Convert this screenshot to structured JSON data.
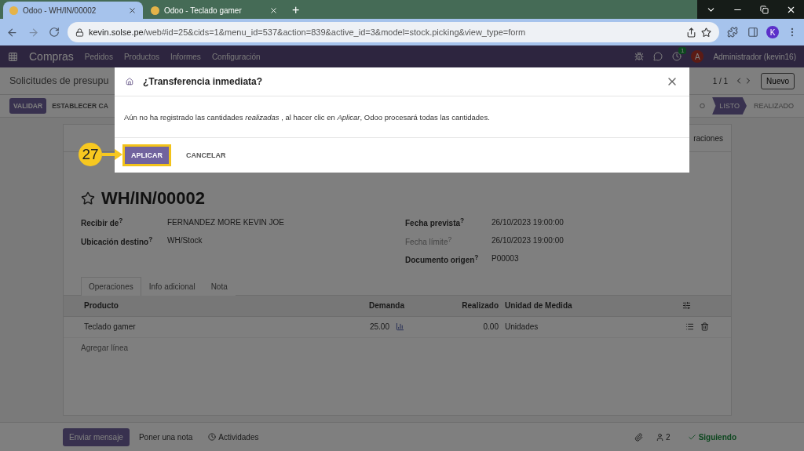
{
  "browser": {
    "tabs": [
      {
        "title": "Odoo - WH/IN/00002",
        "selected": true
      },
      {
        "title": "Odoo - Teclado gamer",
        "selected": false
      }
    ],
    "new_tab": "+",
    "url_host": "kevin.solse.pe",
    "url_path": "/web#id=25&cids=1&menu_id=537&action=839&active_id=3&model=stock.picking&view_type=form",
    "profile": "K"
  },
  "navbar": {
    "app": "Compras",
    "menu": [
      "Pedidos",
      "Productos",
      "Informes",
      "Configuración"
    ],
    "activity_count": "1",
    "user_initial": "A",
    "user": "Administrador (kevin16)"
  },
  "control_panel": {
    "breadcrumb": "Solicitudes de presupu",
    "pager": "1 / 1",
    "new_button": "Nuevo"
  },
  "status_bar": {
    "buttons": [
      {
        "label": "VALIDAR",
        "primary": true
      },
      {
        "label": "ESTABLECER CA",
        "primary": false
      }
    ],
    "stages": [
      {
        "label": "O",
        "selected": false
      },
      {
        "label": "LISTO",
        "selected": true
      },
      {
        "label": "REALIZADO",
        "selected": false
      }
    ]
  },
  "sheet": {
    "smart_button": "raciones",
    "title": "WH/IN/00002",
    "favorite": false,
    "left_fields": [
      {
        "label": "Recibir de$^{?}$",
        "value": "FERNANDEZ MORE KEVIN JOE",
        "muted": false
      },
      {
        "label": "Ubicación destino$^{?}$",
        "value": "WH/Stock",
        "muted": false
      }
    ],
    "right_fields": [
      {
        "label": "Fecha prevista$^{?}$",
        "value": "26/10/2023 19:00:00",
        "muted": false
      },
      {
        "label": "Fecha límite$^{?}$",
        "value": "26/10/2023 19:00:00",
        "muted": true
      },
      {
        "label": "Documento origen$^{?}$",
        "value": "P00003",
        "muted": false
      }
    ],
    "tabs": [
      {
        "label": "Operaciones",
        "selected": true
      },
      {
        "label": "Info adicional",
        "selected": false
      },
      {
        "label": "Nota",
        "selected": false
      }
    ],
    "table": {
      "columns": [
        "Producto",
        "Demanda",
        "Realizado",
        "Unidad de Medida"
      ],
      "rows": [
        {
          "product": "Teclado gamer",
          "demand": "25.00",
          "done": "0.00",
          "uom": "Unidades"
        }
      ],
      "add_line": "Agregar línea"
    }
  },
  "chatter": {
    "send": "Enviar mensaje",
    "note": "Poner una nota",
    "activities": "Actividades",
    "followers": "2",
    "following": "Siguiendo"
  },
  "dialog": {
    "title": "¿Transferencia inmediata?",
    "message": "Aún no ha registrado las cantidades *realizadas* , al hacer clic en *Aplicar*, Odoo procesará todas las cantidades.",
    "buttons": [
      {
        "label": "APLICAR",
        "primary": true,
        "highlighted": true
      },
      {
        "label": "CANCELAR",
        "primary": false,
        "highlighted": false
      }
    ]
  },
  "annotation": {
    "step": "27"
  }
}
